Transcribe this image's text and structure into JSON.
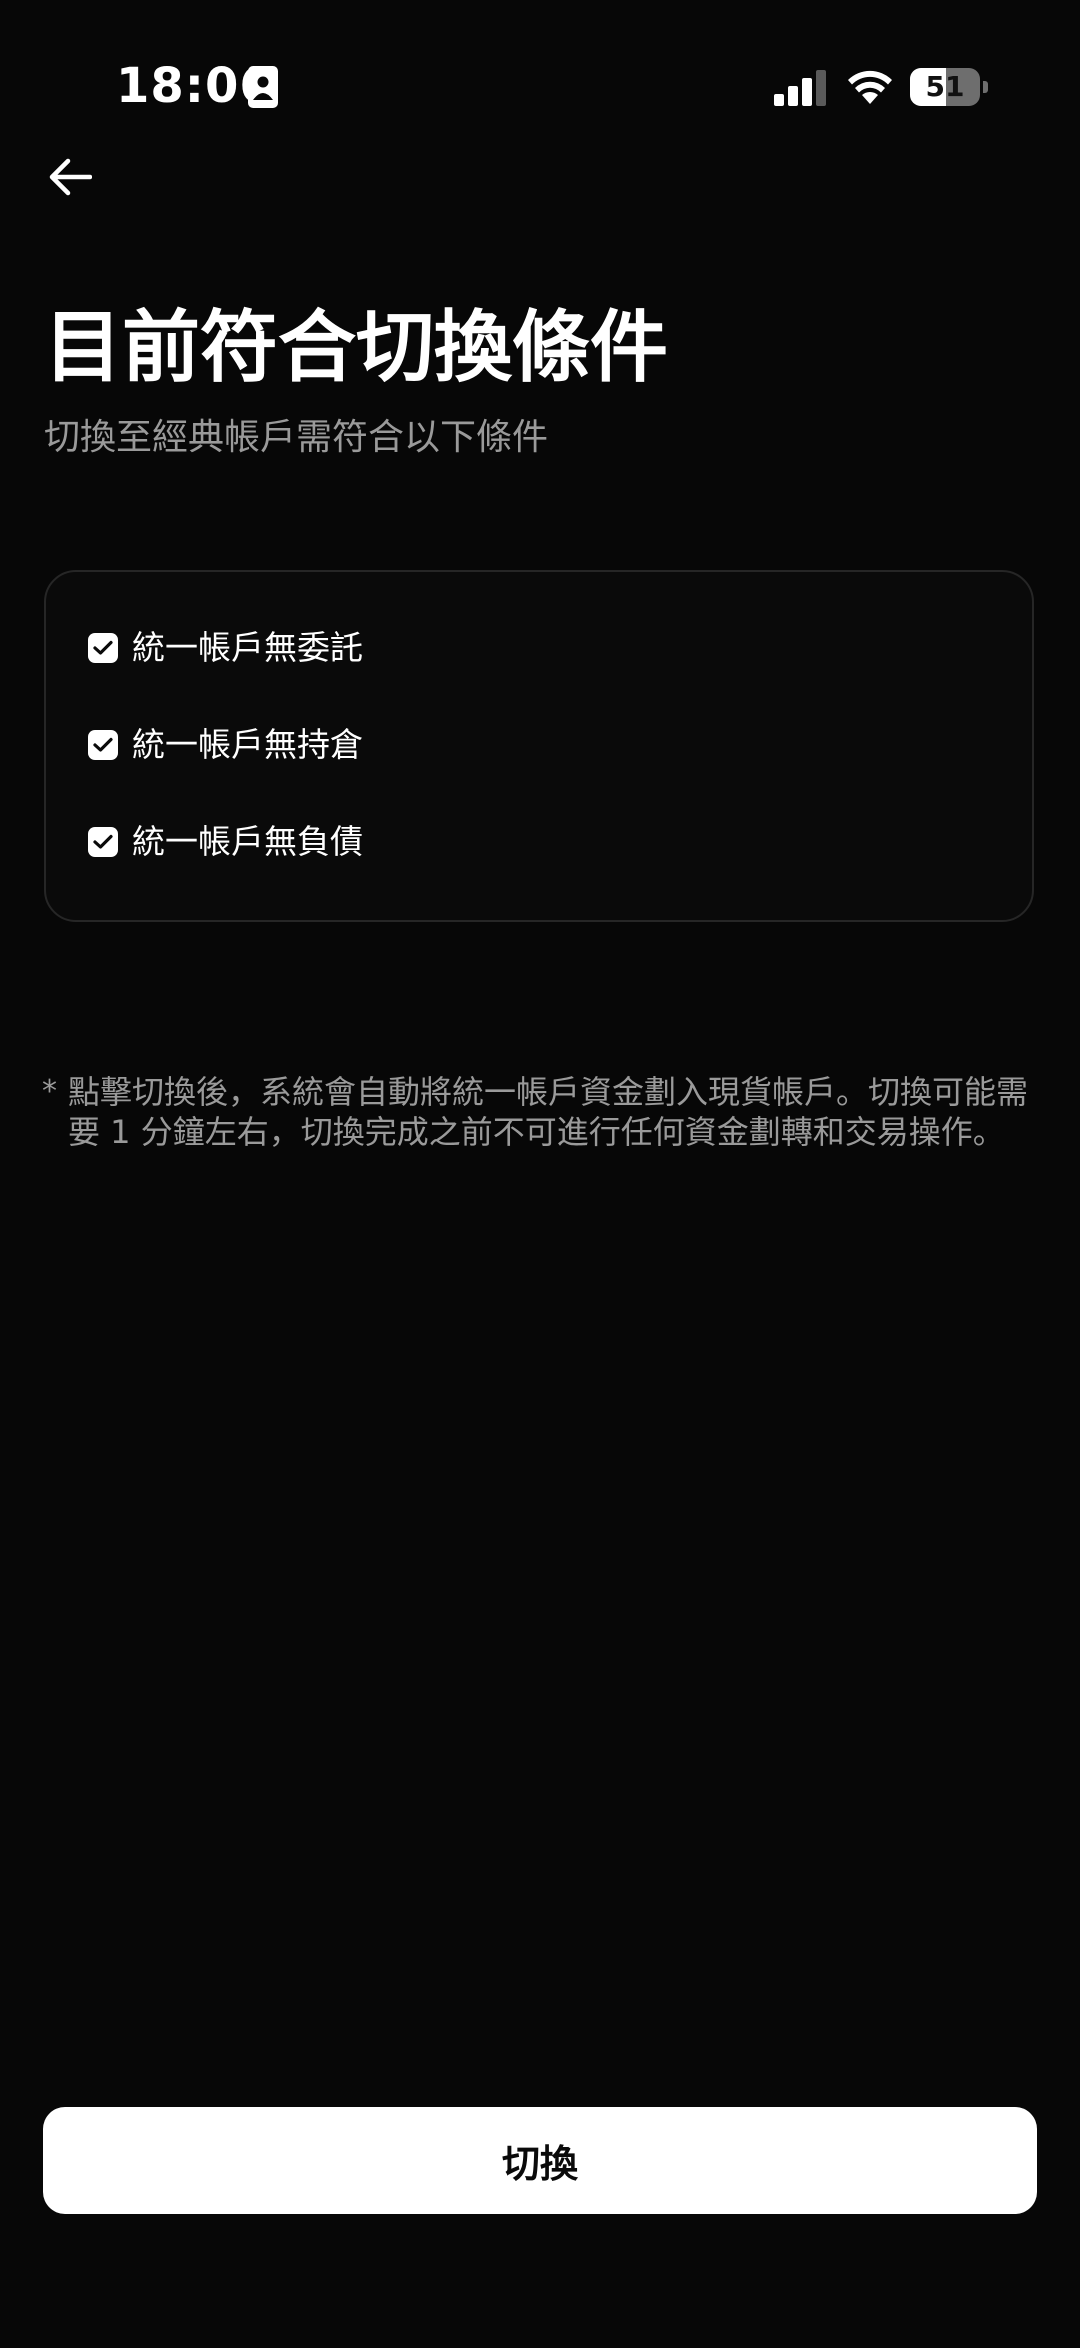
{
  "status_bar": {
    "time": "18:06",
    "battery_percent": "51",
    "battery_level": 0.51,
    "icons": [
      "id-card-icon",
      "signal-icon",
      "wifi-icon",
      "battery-icon"
    ]
  },
  "navigation": {
    "back_icon": "arrow-left-icon"
  },
  "header": {
    "title": "目前符合切換條件",
    "subtitle": "切換至經典帳戶需符合以下條件"
  },
  "conditions": [
    {
      "label": "統一帳戶無委託",
      "checked": true
    },
    {
      "label": "統一帳戶無持倉",
      "checked": true
    },
    {
      "label": "統一帳戶無負債",
      "checked": true
    }
  ],
  "note": {
    "marker": "*",
    "text": "點擊切換後，系統會自動將統一帳戶資金劃入現貨帳戶。切換可能需要 1 分鐘左右，切換完成之前不可進行任何資金劃轉和交易操作。"
  },
  "actions": {
    "switch_label": "切換"
  },
  "colors": {
    "background": "#070707",
    "text_primary": "#ffffff",
    "text_secondary": "#9a9a9a",
    "card_border": "#262626",
    "button_background": "#ffffff",
    "button_text": "#0a0a0a"
  }
}
